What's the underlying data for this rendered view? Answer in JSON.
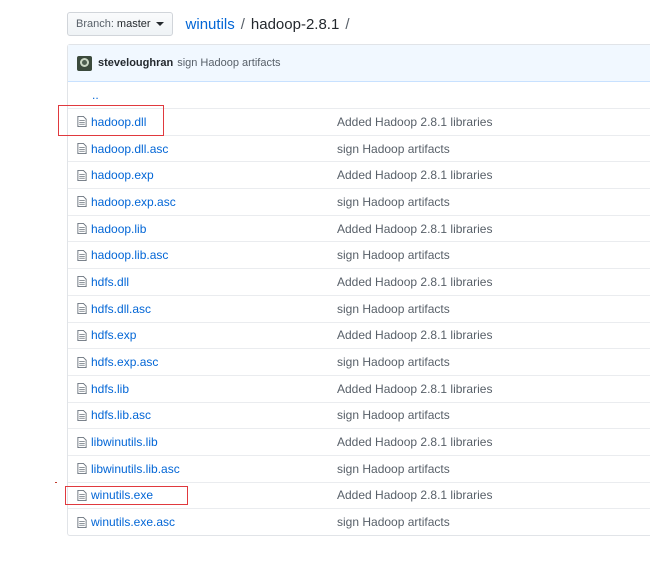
{
  "header": {
    "branch_prefix": "Branch:",
    "branch_name": "master",
    "repo": "winutils",
    "separator": "/",
    "folder": "hadoop-2.8.1",
    "trailing_separator": "/"
  },
  "commit": {
    "author": "steveloughran",
    "message": "sign Hadoop artifacts"
  },
  "parent_link": "..",
  "files": [
    {
      "name": "hadoop.dll",
      "message": "Added Hadoop 2.8.1 libraries",
      "highlighted": true
    },
    {
      "name": "hadoop.dll.asc",
      "message": "sign Hadoop artifacts",
      "highlighted": false
    },
    {
      "name": "hadoop.exp",
      "message": "Added Hadoop 2.8.1 libraries",
      "highlighted": false
    },
    {
      "name": "hadoop.exp.asc",
      "message": "sign Hadoop artifacts",
      "highlighted": false
    },
    {
      "name": "hadoop.lib",
      "message": "Added Hadoop 2.8.1 libraries",
      "highlighted": false
    },
    {
      "name": "hadoop.lib.asc",
      "message": "sign Hadoop artifacts",
      "highlighted": false
    },
    {
      "name": "hdfs.dll",
      "message": "Added Hadoop 2.8.1 libraries",
      "highlighted": false
    },
    {
      "name": "hdfs.dll.asc",
      "message": "sign Hadoop artifacts",
      "highlighted": false
    },
    {
      "name": "hdfs.exp",
      "message": "Added Hadoop 2.8.1 libraries",
      "highlighted": false
    },
    {
      "name": "hdfs.exp.asc",
      "message": "sign Hadoop artifacts",
      "highlighted": false
    },
    {
      "name": "hdfs.lib",
      "message": "Added Hadoop 2.8.1 libraries",
      "highlighted": false
    },
    {
      "name": "hdfs.lib.asc",
      "message": "sign Hadoop artifacts",
      "highlighted": false
    },
    {
      "name": "libwinutils.lib",
      "message": "Added Hadoop 2.8.1 libraries",
      "highlighted": false
    },
    {
      "name": "libwinutils.lib.asc",
      "message": "sign Hadoop artifacts",
      "highlighted": false
    },
    {
      "name": "winutils.exe",
      "message": "Added Hadoop 2.8.1 libraries",
      "highlighted": true
    },
    {
      "name": "winutils.exe.asc",
      "message": "sign Hadoop artifacts",
      "highlighted": false
    }
  ],
  "colors": {
    "link": "#0366d6",
    "muted": "#586069",
    "commit_bg": "#f1f8ff",
    "highlight_box": "#e0393e"
  }
}
